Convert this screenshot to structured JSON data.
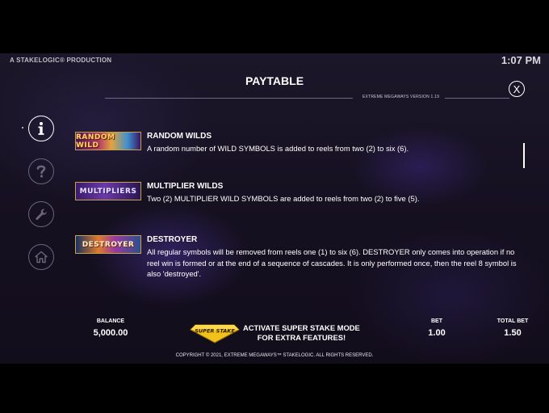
{
  "header": {
    "producer": "A STAKELOGIC® PRODUCTION",
    "clock": "1:07 PM",
    "title": "PAYTABLE",
    "version": "EXTREME MEGAWAYS VERSION 1.19",
    "close_label": "X"
  },
  "nav": [
    {
      "icon": "info-icon",
      "active": true
    },
    {
      "icon": "help-icon",
      "active": false
    },
    {
      "icon": "wrench-icon",
      "active": false
    },
    {
      "icon": "home-icon",
      "active": false
    }
  ],
  "features": [
    {
      "thumb": "RANDOM WILD",
      "title": "RANDOM WILDS",
      "desc": "A random number of WILD SYMBOLS is added to reels from two (2) to six (6)."
    },
    {
      "thumb": "MULTIPLIERS",
      "title": "MULTIPLIER WILDS",
      "desc": "Two (2) MULTIPLIER WILD SYMBOLS are added to reels from two (2) to five (5)."
    },
    {
      "thumb": "DESTROYER",
      "title": "DESTROYER",
      "desc": "All regular symbols will be removed from reels one (1) to six (6). DESTROYER only comes into operation if no reel win is formed or at the end of a sequence of cascades. It is only performed once, then the reel 8 symbol is also 'destroyed'."
    }
  ],
  "footer": {
    "balance_label": "BALANCE",
    "balance_value": "5,000.00",
    "super_stake_logo": "SUPER STAKE",
    "super_stake_line1": "ACTIVATE SUPER STAKE MODE",
    "super_stake_line2": "FOR EXTRA FEATURES!",
    "bet_label": "BET",
    "bet_value": "1.00",
    "total_bet_label": "TOTAL BET",
    "total_bet_value": "1.50",
    "copyright": "COPYRIGHT © 2021, EXTREME MEGAWAYS™ STAKELOGIC. ALL RIGHTS RESERVED."
  },
  "colors": {
    "accent_gold": "#f2c21b",
    "border_gold": "#c8a24a"
  }
}
